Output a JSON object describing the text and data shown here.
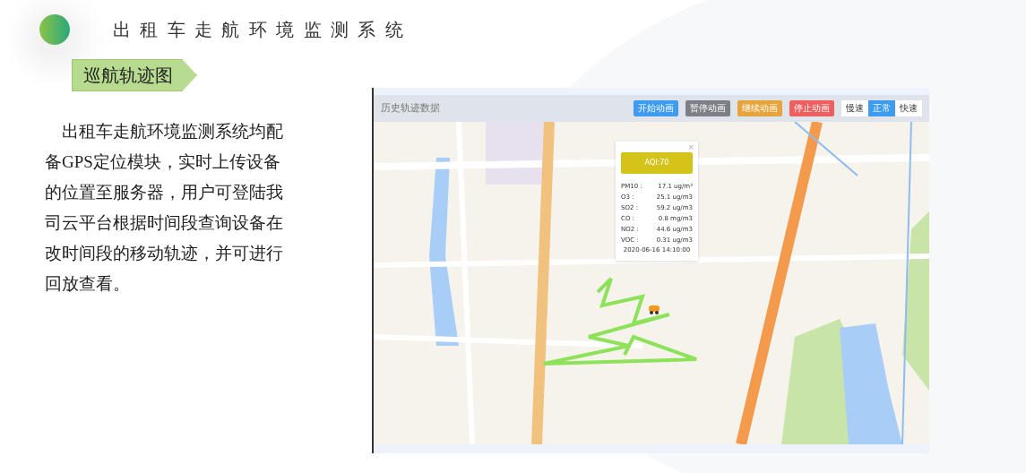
{
  "title": "出 租 车 走 航 环 境 监 测 系 统",
  "section_label": "巡航轨迹图",
  "description": "出租车走航环境监测系统均配备GPS定位模块，实时上传设备的位置至服务器，用户可登陆我司云平台根据时间段查询设备在改时间段的移动轨迹，并可进行回放查看。",
  "app": {
    "title": "历史轨迹数据",
    "buttons": [
      {
        "label": "开始动画",
        "color": "#3d9cf0"
      },
      {
        "label": "暂停动画",
        "color": "#7d7f86"
      },
      {
        "label": "继续动画",
        "color": "#e8a43c"
      },
      {
        "label": "停止动画",
        "color": "#ee5f5f"
      }
    ],
    "speed_options": [
      {
        "label": "慢速",
        "selected": false
      },
      {
        "label": "正常",
        "selected": true
      },
      {
        "label": "快速",
        "selected": false
      }
    ],
    "popup": {
      "close": "×",
      "aqi": "AQI:70",
      "readings": [
        {
          "name": "PM10 :",
          "value": "17.1 ug/m³"
        },
        {
          "name": "O3 :",
          "value": "25.1 ug/m3"
        },
        {
          "name": "SO2 :",
          "value": "59.2 ug/m3"
        },
        {
          "name": "CO :",
          "value": "0.8 mg/m3"
        },
        {
          "name": "NO2 :",
          "value": "44.6 ug/m3"
        },
        {
          "name": "VOC :",
          "value": "0.31 ug/m3"
        }
      ],
      "time": "2020-06-16 14:10:00"
    }
  }
}
